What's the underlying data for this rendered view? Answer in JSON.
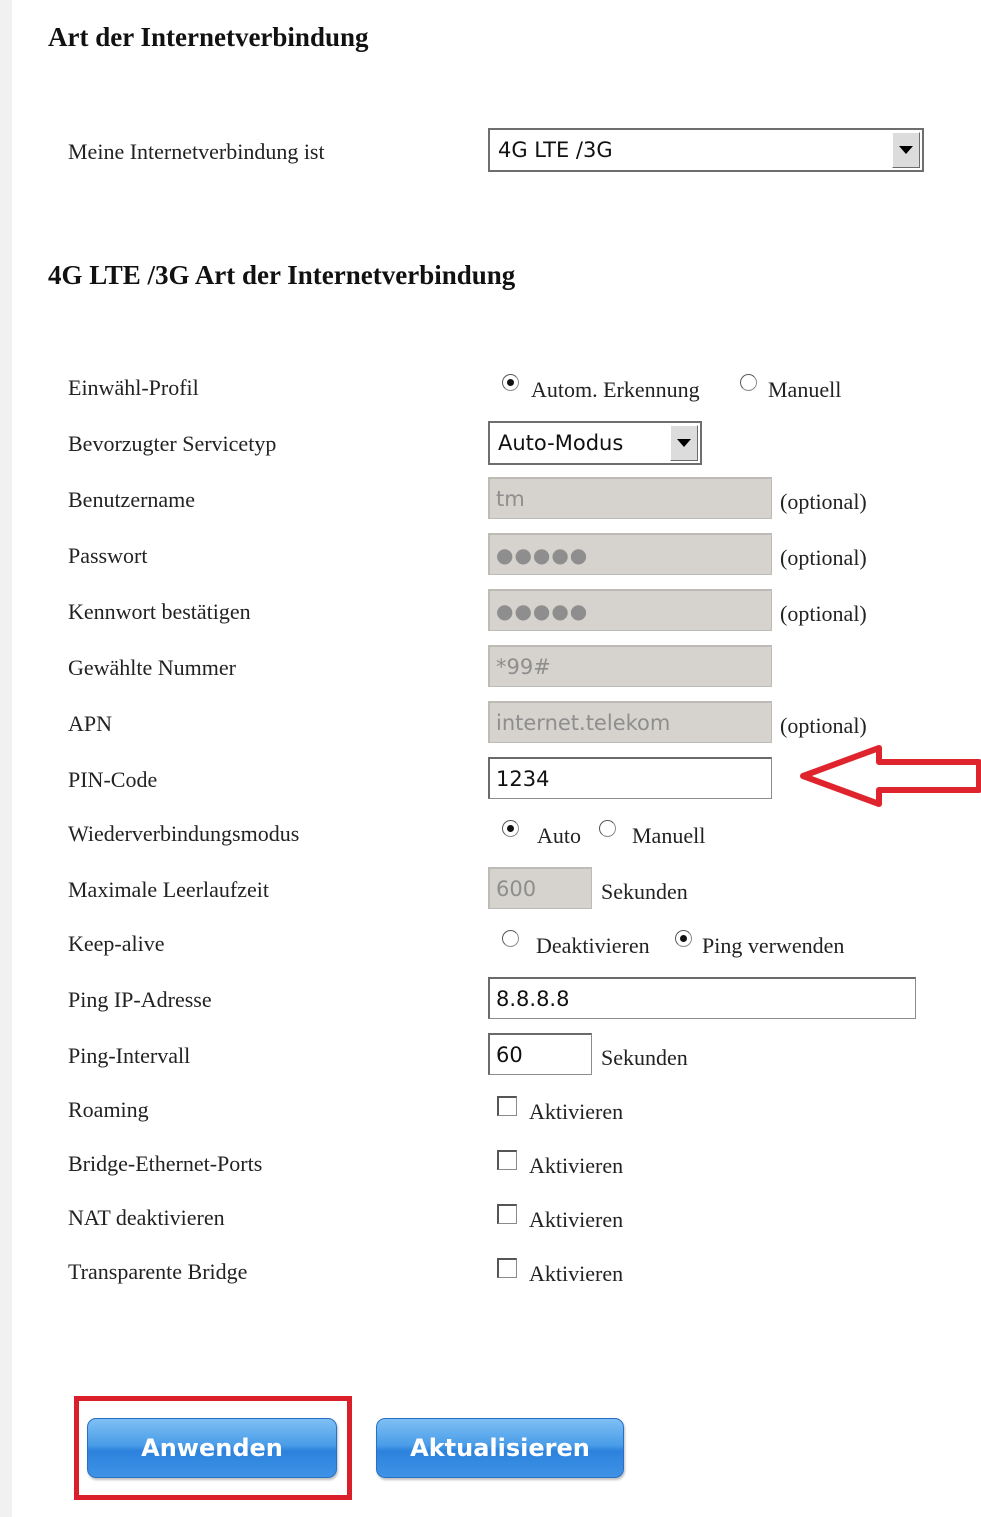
{
  "section1": {
    "title": "Art der Internetverbindung",
    "connection_label": "Meine Internetverbindung ist",
    "connection_value": "4G LTE /3G"
  },
  "section2": {
    "title": "4G LTE /3G Art der Internetverbindung",
    "profile": {
      "label": "Einwähl-Profil",
      "options": [
        "Autom. Erkennung",
        "Manuell"
      ],
      "selected": "Autom. Erkennung"
    },
    "service_type": {
      "label": "Bevorzugter Servicetyp",
      "value": "Auto-Modus"
    },
    "username": {
      "label": "Benutzername",
      "value": "tm",
      "note": "(optional)"
    },
    "password": {
      "label": "Passwort",
      "value": "●●●●●",
      "note": "(optional)"
    },
    "confirm_password": {
      "label": "Kennwort bestätigen",
      "value": "●●●●●",
      "note": "(optional)"
    },
    "dial_number": {
      "label": "Gewählte Nummer",
      "value": "*99#"
    },
    "apn": {
      "label": "APN",
      "value": "internet.telekom",
      "note": "(optional)"
    },
    "pin": {
      "label": "PIN-Code",
      "value": "1234"
    },
    "reconnect_mode": {
      "label": "Wiederverbindungsmodus",
      "options": [
        "Auto",
        "Manuell"
      ],
      "selected": "Auto"
    },
    "idle_time": {
      "label": "Maximale Leerlaufzeit",
      "value": "600",
      "unit": "Sekunden"
    },
    "keep_alive": {
      "label": "Keep-alive",
      "options": [
        "Deaktivieren",
        "Ping verwenden"
      ],
      "selected": "Ping verwenden"
    },
    "ping_ip": {
      "label": "Ping IP-Adresse",
      "value": "8.8.8.8"
    },
    "ping_interval": {
      "label": "Ping-Intervall",
      "value": "60",
      "unit": "Sekunden"
    },
    "roaming": {
      "label": "Roaming",
      "option": "Aktivieren",
      "checked": false
    },
    "bridge_ports": {
      "label": "Bridge-Ethernet-Ports",
      "option": "Aktivieren",
      "checked": false
    },
    "nat_disable": {
      "label": "NAT deaktivieren",
      "option": "Aktivieren",
      "checked": false
    },
    "transparent_bridge": {
      "label": "Transparente Bridge",
      "option": "Aktivieren",
      "checked": false
    }
  },
  "buttons": {
    "apply": "Anwenden",
    "refresh": "Aktualisieren"
  },
  "colors": {
    "button_blue": "#3f93e6",
    "highlight_red": "#d81f2a",
    "disabled_field": "#d6d3ce"
  }
}
